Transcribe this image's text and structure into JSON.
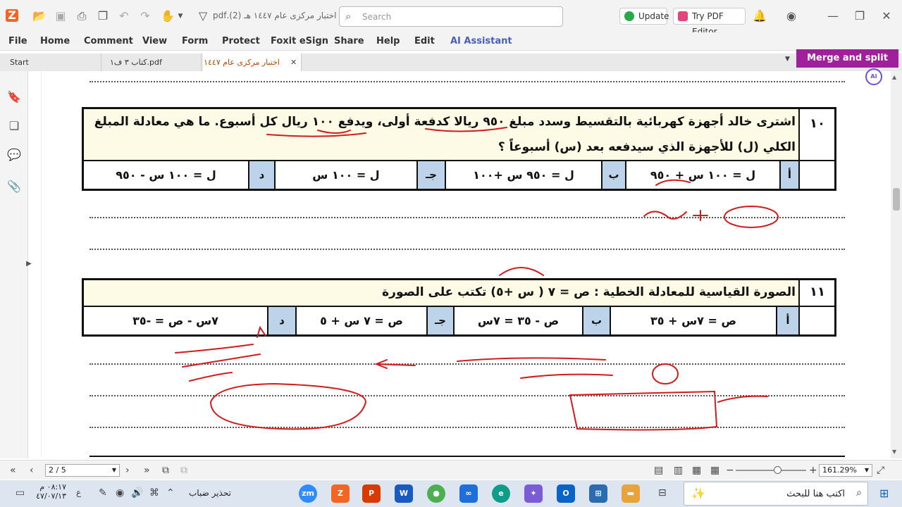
{
  "toolbar": {
    "doc_title": "اختبار مركزى عام ١٤٤٧ هـ (2).pdf",
    "search_placeholder": "Search",
    "update_label": "Update",
    "try_editor_label": "Try PDF Editor"
  },
  "menu": [
    "File",
    "Home",
    "Comment",
    "View",
    "Form",
    "Protect",
    "Foxit eSign",
    "Share",
    "Help",
    "Edit",
    "AI Assistant"
  ],
  "tabs": [
    "Start",
    "كتاب ٣ ف١.pdf",
    "اختبار مركزى عام ١٤٤٧ هـ ..."
  ],
  "merge_label": "Merge and split PDFs",
  "questions": {
    "q10": {
      "number": "١٠",
      "line1": "اشترى خالد أجهزة كهربائية بالتقسيط وسدد مبلغ ٩٥٠ ريالا كدفعة أولى، ويدفع ١٠٠ ريال كل أسبوع. ما هي معادلة المبلغ",
      "line2": "الكلي (ل) للأجهزة الذي سيدفعه بعد (س) أسبوعاً ؟",
      "labels": [
        "أ",
        "ب",
        "جـ",
        "د"
      ],
      "options": [
        "ل = ١٠٠ س + ٩٥٠",
        "ل = ٩٥٠ س +١٠٠",
        "ل = ١٠٠ س",
        "ل = ١٠٠ س - ٩٥٠"
      ]
    },
    "q11": {
      "number": "١١",
      "line1": "الصورة القياسية للمعادلة الخطية :   ص = ٧ ( س +٥) تكتب على الصورة",
      "labels": [
        "أ",
        "ب",
        "جـ",
        "د"
      ],
      "options": [
        "ص = ٧س + ٣٥",
        "ص - ٣٥ = ٧س",
        "ص = ٧ س + ٥",
        "٧س - ص = -٣٥"
      ]
    }
  },
  "status": {
    "page": "2 / 5",
    "zoom": "161.29%"
  },
  "taskbar": {
    "time": "٠٨:١٧ م",
    "date": "٤٧/٠٧/١٣",
    "weather": "تحذير ضباب",
    "search_text": "اكتب هنا للبحث"
  }
}
